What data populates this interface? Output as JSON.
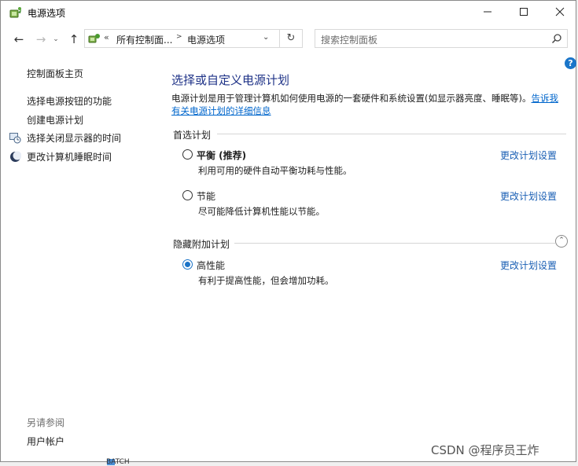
{
  "window": {
    "title": "电源选项",
    "icons": {
      "app": "power-options-icon",
      "minimize": "minimize-icon",
      "maximize": "maximize-icon",
      "close": "close-icon"
    }
  },
  "nav": {
    "back": "←",
    "forward": "→",
    "recent": "⌄",
    "up": "↑",
    "breadcrumb_prefix": "«",
    "breadcrumb": [
      "所有控制面...",
      "电源选项"
    ],
    "breadcrumb_sep": ">",
    "dropdown": "⌄",
    "refresh": "↻",
    "search_placeholder": "搜索控制面板"
  },
  "help": {
    "label": "?"
  },
  "sidebar": {
    "home": "控制面板主页",
    "items": [
      {
        "label": "选择电源按钮的功能",
        "icon": ""
      },
      {
        "label": "创建电源计划",
        "icon": ""
      },
      {
        "label": "选择关闭显示器的时间",
        "icon": "monitor-clock-icon"
      },
      {
        "label": "更改计算机睡眠时间",
        "icon": "moon-icon"
      }
    ],
    "see_also": "另请参阅",
    "see_also_items": [
      "用户帐户"
    ]
  },
  "main": {
    "title": "选择或自定义电源计划",
    "description": "电源计划是用于管理计算机如何使用电源的一套硬件和系统设置(如显示器亮度、睡眠等)。",
    "description_link": "告诉我有关电源计划的详细信息",
    "preferred_section": "首选计划",
    "hidden_section": "隐藏附加计划",
    "collapse": "⌃",
    "plans": [
      {
        "name": "平衡 (推荐)",
        "desc": "利用可用的硬件自动平衡功耗与性能。",
        "link": "更改计划设置",
        "selected": false
      },
      {
        "name": "节能",
        "desc": "尽可能降低计算机性能以节能。",
        "link": "更改计划设置",
        "selected": false
      },
      {
        "name": "高性能",
        "desc": "有利于提高性能，但会增加功耗。",
        "link": "更改计划设置",
        "selected": true
      }
    ]
  },
  "background": {
    "taskbar_text": "BATCH",
    "watermark": "CSDN @程序员王炸"
  },
  "colors": {
    "accent": "#1a73c7",
    "link": "#0066cc",
    "title": "#1e3287"
  }
}
